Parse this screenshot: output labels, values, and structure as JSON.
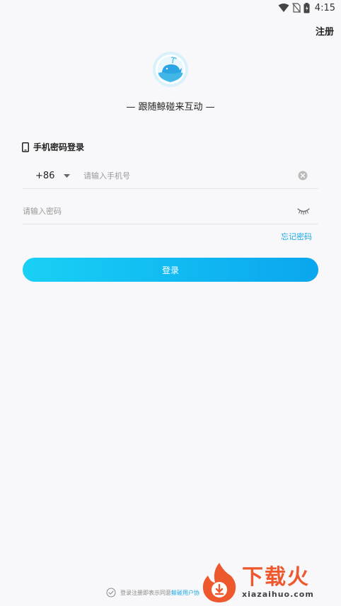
{
  "status_bar": {
    "time": "4:15",
    "icons": [
      "wifi-icon",
      "no-sim-icon",
      "battery-icon"
    ]
  },
  "header": {
    "register_label": "注册"
  },
  "branding": {
    "logo_icon": "whale-logo-icon",
    "slogan": "跟随鲸碰来互动"
  },
  "login": {
    "section_title": "手机密码登录",
    "phone": {
      "country_code": "+86",
      "placeholder": "请输入手机号",
      "value": ""
    },
    "password": {
      "placeholder": "请输入密码",
      "value": ""
    },
    "forgot_label": "忘记密码",
    "submit_label": "登录"
  },
  "agreement": {
    "prefix": "登录注册即表示同意",
    "link": "鲸碰用户协"
  },
  "watermark": {
    "big": "下载火",
    "small": "xiazaihuo.com"
  },
  "colors": {
    "accent": "#1aa8e8",
    "button_start": "#19d0f5",
    "button_end": "#0aa6ee",
    "watermark": "#ee4b1c"
  }
}
